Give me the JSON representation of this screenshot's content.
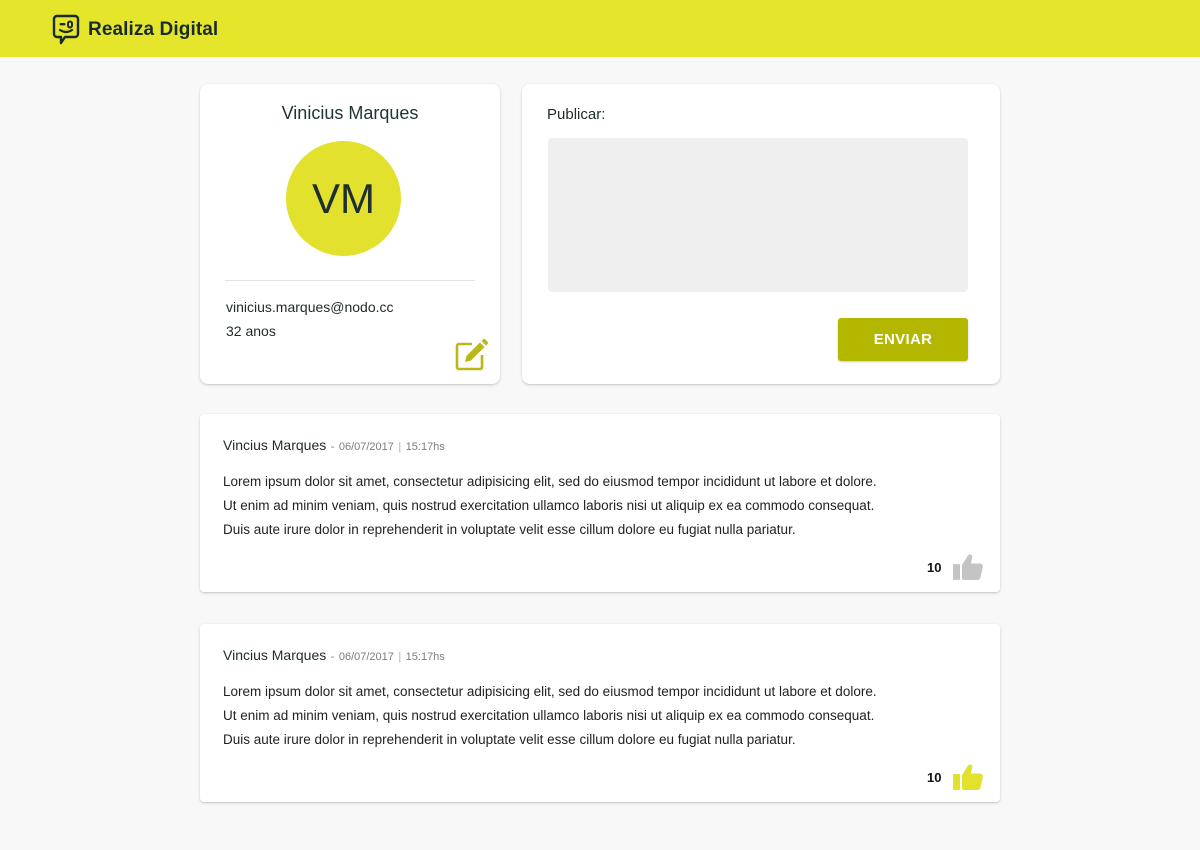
{
  "app": {
    "name": "Realiza Digital",
    "accent_color": "#e5e52b",
    "button_color": "#b3b700",
    "logo_icon": "chat-face-icon"
  },
  "profile": {
    "name": "Vinicius Marques",
    "initials": "VM",
    "email": "vinicius.marques@nodo.cc",
    "age": "32 anos",
    "edit_icon": "edit-icon"
  },
  "publish": {
    "label": "Publicar:",
    "text_value": "",
    "placeholder": "",
    "send_label": "ENVIAR"
  },
  "posts": [
    {
      "author": "Vincius Marques",
      "dash": "-",
      "date": "06/07/2017",
      "separator": "|",
      "time": "15:17hs",
      "lines": [
        "Lorem ipsum dolor sit amet, consectetur adipisicing elit, sed do eiusmod tempor incididunt ut labore et dolore.",
        "Ut enim ad minim veniam, quis nostrud exercitation ullamco laboris nisi ut aliquip ex ea commodo consequat.",
        "Duis aute irure dolor in reprehenderit in voluptate velit esse cillum dolore eu fugiat nulla pariatur."
      ],
      "likes": "10",
      "liked": false,
      "like_color": "#c4c4c4",
      "like_icon": "thumbs-up-icon"
    },
    {
      "author": "Vincius Marques",
      "dash": "-",
      "date": "06/07/2017",
      "separator": "|",
      "time": "15:17hs",
      "lines": [
        "Lorem ipsum dolor sit amet, consectetur adipisicing elit, sed do eiusmod tempor incididunt ut labore et dolore.",
        "Ut enim ad minim veniam, quis nostrud exercitation ullamco laboris nisi ut aliquip ex ea commodo consequat.",
        "Duis aute irure dolor in reprehenderit in voluptate velit esse cillum dolore eu fugiat nulla pariatur."
      ],
      "likes": "10",
      "liked": true,
      "like_color": "#e1e12e",
      "like_icon": "thumbs-up-icon"
    }
  ]
}
